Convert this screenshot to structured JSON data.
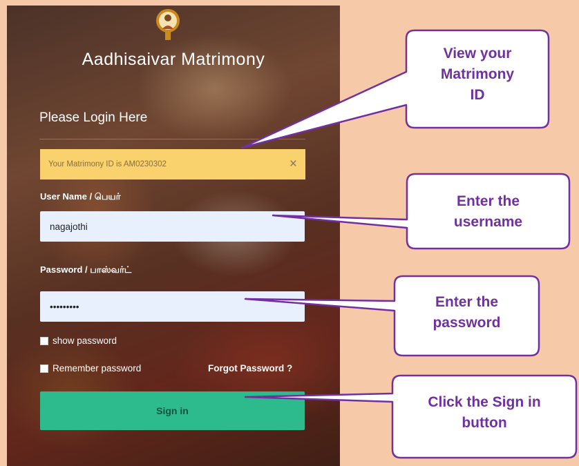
{
  "app": {
    "title": "Aadhisaivar Matrimony"
  },
  "login": {
    "heading": "Please Login Here",
    "alert_text": "Your Matrimony ID is AM0230302",
    "alert_close": "×",
    "username_label": "User Name / பெயர்",
    "username_value": "nagajothi",
    "password_label": "Password / பாஸ்வர்ட்",
    "password_value": "nagajothi",
    "show_password_label": "show password",
    "remember_label": "Remember password",
    "forgot_label": "Forgot Password ?",
    "signin_label": "Sign in"
  },
  "callouts": {
    "view_id": [
      "View your",
      "Matrimony",
      "ID"
    ],
    "username": [
      "Enter the",
      "username"
    ],
    "password": [
      "Enter the",
      "password"
    ],
    "signin": [
      "Click the Sign in",
      "button"
    ]
  },
  "colors": {
    "callout_border": "#7030a0",
    "callout_text": "#7030a0",
    "background": "#f6c9a9",
    "signin_button": "#2dbb8e",
    "alert_bg": "#f9d26e"
  }
}
